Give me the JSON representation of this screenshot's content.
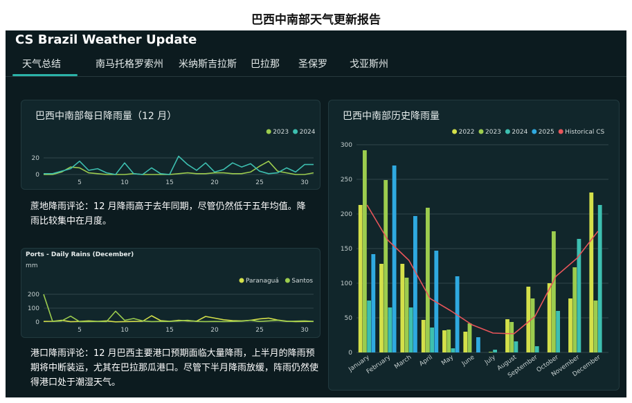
{
  "document_title": "巴西中南部天气更新报告",
  "app_title": "CS Brazil Weather Update",
  "tabs": [
    {
      "label": "天气总结",
      "active": true
    },
    {
      "label": "南马托格罗索州",
      "active": false
    },
    {
      "label": "米纳斯吉拉斯",
      "active": false
    },
    {
      "label": "巴拉那",
      "active": false
    },
    {
      "label": "圣保罗",
      "active": false
    },
    {
      "label": "戈亚斯州",
      "active": false
    }
  ],
  "colors": {
    "background": "#0c1b1f",
    "card": "#11262b",
    "accent": "#2bb3a8",
    "s2022": "#d4e04a",
    "s2023": "#9ccc4e",
    "s2024": "#3dbfb0",
    "s2025": "#2fa9e0",
    "historical": "#e8555a",
    "grid": "#3c5257",
    "tick": "#c6d0d0"
  },
  "panel1": {
    "title": "巴西中南部每日降雨量（12 月）",
    "comment": "蔗地降雨评论：12 月降雨高于去年同期，尽管仍然低于五年均值。降雨比较集中在月度。"
  },
  "panel2": {
    "title": "Ports - Daily Rains (December)",
    "unit": "mm",
    "comment": "港口降雨评论：12 月巴西主要港口预期面临大量降雨，上半月的降雨预期将中断装运，尤其在巴拉那瓜港口。尽管下半月降雨放缓，阵雨仍然使得港口处于潮湿天气。"
  },
  "panel3": {
    "title": "巴西中南部历史降雨量"
  },
  "chart_data": [
    {
      "type": "line",
      "title": "巴西中南部每日降雨量（12 月）",
      "x": [
        1,
        2,
        3,
        4,
        5,
        6,
        7,
        8,
        9,
        10,
        11,
        12,
        13,
        14,
        15,
        16,
        17,
        18,
        19,
        20,
        21,
        22,
        23,
        24,
        25,
        26,
        27,
        28,
        29,
        30,
        31
      ],
      "xticks": [
        5,
        10,
        15,
        20,
        25,
        30
      ],
      "ylim": [
        0,
        25
      ],
      "yticks": [
        0,
        20
      ],
      "grid": true,
      "legend": "top-right",
      "series": [
        {
          "name": "2023",
          "color": "#9ccc4e",
          "values": [
            0,
            0,
            3,
            9,
            8,
            2,
            1,
            0,
            0,
            0,
            1,
            0,
            0,
            0,
            0,
            1,
            2,
            1,
            1,
            2,
            2,
            1,
            1,
            3,
            10,
            16,
            4,
            2,
            0,
            0,
            2
          ]
        },
        {
          "name": "2024",
          "color": "#3dbfb0",
          "values": [
            1,
            1,
            4,
            7,
            16,
            5,
            7,
            2,
            0,
            14,
            1,
            0,
            8,
            1,
            0,
            22,
            12,
            5,
            14,
            3,
            6,
            14,
            9,
            13,
            4,
            1,
            2,
            8,
            3,
            12,
            12
          ]
        }
      ]
    },
    {
      "type": "line",
      "title": "Ports - Daily Rains (December)",
      "ylabel": "mm",
      "x": [
        1,
        2,
        3,
        4,
        5,
        6,
        7,
        8,
        9,
        10,
        11,
        12,
        13,
        14,
        15,
        16,
        17,
        18,
        19,
        20,
        21,
        22,
        23,
        24,
        25,
        26,
        27,
        28,
        29,
        30,
        31
      ],
      "xticks": [
        5,
        10,
        15,
        20,
        25,
        30
      ],
      "ylim": [
        0,
        210
      ],
      "yticks": [
        0,
        100,
        200
      ],
      "grid": true,
      "legend": "top-right",
      "series": [
        {
          "name": "Paranaguá",
          "color": "#d4e04a",
          "values": [
            4,
            5,
            12,
            2,
            4,
            8,
            4,
            8,
            1,
            3,
            4,
            5,
            45,
            10,
            5,
            12,
            8,
            6,
            40,
            28,
            16,
            10,
            8,
            12,
            22,
            28,
            14,
            6,
            3,
            4,
            4
          ]
        },
        {
          "name": "Santos",
          "color": "#9ccc4e",
          "values": [
            200,
            4,
            8,
            42,
            2,
            3,
            4,
            3,
            78,
            12,
            25,
            8,
            3,
            4,
            4,
            8,
            12,
            4,
            3,
            4,
            3,
            4,
            6,
            12,
            4,
            8,
            12,
            4,
            6,
            8,
            4
          ]
        }
      ]
    },
    {
      "type": "bar",
      "title": "巴西中南部历史降雨量",
      "categories": [
        "January",
        "February",
        "March",
        "April",
        "May",
        "June",
        "July",
        "August",
        "September",
        "October",
        "November",
        "December"
      ],
      "ylim": [
        0,
        300
      ],
      "yticks": [
        0,
        50,
        100,
        150,
        200,
        250,
        300
      ],
      "grid": true,
      "legend": "top-right",
      "series": [
        {
          "name": "2022",
          "color": "#d4e04a",
          "values": [
            213,
            128,
            128,
            47,
            32,
            30,
            0,
            48,
            95,
            100,
            78,
            231
          ]
        },
        {
          "name": "2023",
          "color": "#9ccc4e",
          "values": [
            292,
            249,
            108,
            209,
            33,
            42,
            1,
            44,
            78,
            175,
            123,
            75
          ]
        },
        {
          "name": "2024",
          "color": "#3dbfb0",
          "values": [
            75,
            65,
            65,
            36,
            6,
            0,
            4,
            16,
            9,
            60,
            164,
            213
          ]
        },
        {
          "name": "2025",
          "color": "#2fa9e0",
          "values": [
            142,
            270,
            197,
            147,
            110,
            22,
            0,
            0,
            0,
            0,
            0,
            0
          ]
        }
      ],
      "line_series": {
        "name": "Historical CS",
        "color": "#e8555a",
        "values": [
          213,
          162,
          133,
          78,
          60,
          40,
          28,
          27,
          52,
          110,
          136,
          175
        ]
      }
    }
  ]
}
